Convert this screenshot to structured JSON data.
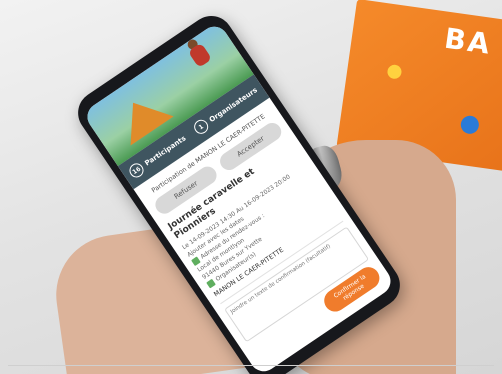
{
  "book": {
    "letters": "BA"
  },
  "app": {
    "tabs": [
      {
        "count": "16",
        "label": "Participants"
      },
      {
        "count": "1",
        "label": "Organisateurs"
      }
    ],
    "participation_text": "Participation de MANON LE CAER-PITETTE",
    "refuse_label": "Refuser",
    "accept_label": "Accepter",
    "event_title": "Journée caravelle et Pionniers",
    "date_text": "Le 14-09-2023 14:30 Au 16-09-2023 20:00",
    "add_calendar": "Ajouter avec les dates",
    "address_label": "Adresse du rendez-vous :",
    "address_line1": "Local de montlyon",
    "address_line2": "91440 Bures sur Yvette",
    "organizer_label": "Organisateur(s)",
    "organizer_name": "MANON LE CAER-PITETTE",
    "message_placeholder": "Joindre un texte de confirmation (facultatif)",
    "confirm_label": "Confirmer la réponse"
  }
}
